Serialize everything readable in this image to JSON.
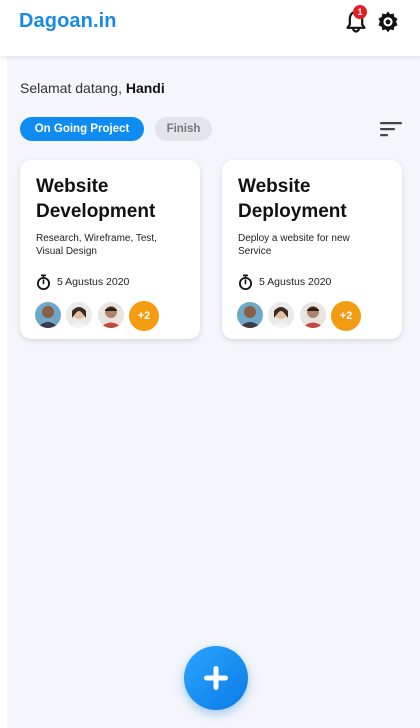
{
  "app": {
    "brand": "Dagoan.in",
    "brand_color": "#1789e8",
    "notification_count": "1"
  },
  "greeting": {
    "prefix": "Selamat datang,",
    "name": "Handi"
  },
  "tabs": [
    {
      "label": "On Going Project",
      "active": true
    },
    {
      "label": "Finish",
      "active": false
    }
  ],
  "projects": [
    {
      "title": "Website Development",
      "description": "Research, Wireframe, Test, Visual Design",
      "date": "5 Agustus 2020",
      "extra_members": "+2"
    },
    {
      "title": "Website Deployment",
      "description": "Deploy a website for new Service",
      "date": "5 Agustus 2020",
      "extra_members": "+2"
    }
  ],
  "icons": {
    "notification": "bell-icon",
    "settings": "gear-icon",
    "sort": "sort-icon",
    "date": "stopwatch-icon",
    "add": "plus-icon"
  },
  "colors": {
    "accent": "#0f8cf2",
    "badge": "#e21d23",
    "member_more": "#f39c12"
  }
}
